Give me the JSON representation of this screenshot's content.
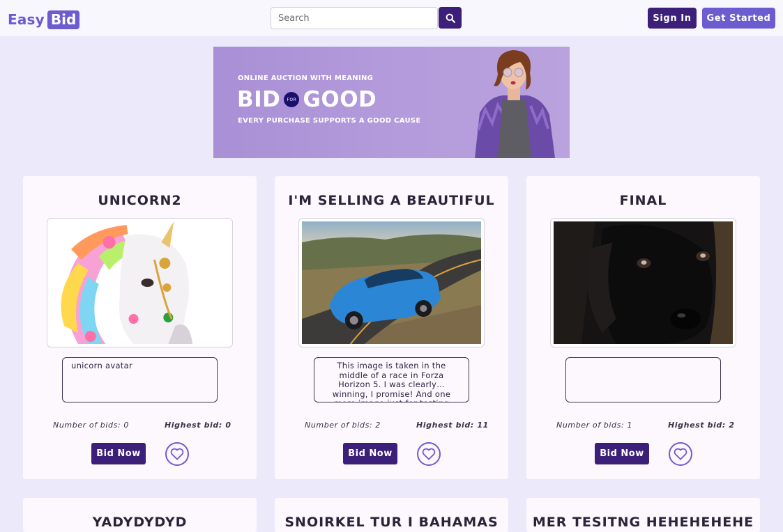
{
  "header": {
    "logo_part1": "Easy",
    "logo_part2": "Bid",
    "search_placeholder": "Search",
    "signin_label": "Sign In",
    "get_started_label": "Get Started"
  },
  "banner": {
    "kicker": "ONLINE AUCTION WITH MEANING",
    "headline_left": "BID",
    "headline_connector": "FOR",
    "headline_right": "GOOD",
    "subline": "EVERY PURCHASE SUPPORTS A GOOD CAUSE"
  },
  "colors": {
    "page_bg": "#ece9fb",
    "primary_dark": "#3b1f78",
    "primary_light": "#6c5ccf",
    "card_bg": "#fdf7fe"
  },
  "cards": [
    {
      "title": "UNICORN2",
      "description": "unicorn avatar",
      "bids_text": "Number of bids: 0",
      "highest_text": "Highest bid: 0",
      "bid_label": "Bid Now",
      "image": "unicorn-image"
    },
    {
      "title": "I'M SELLING A BEAUTIFUL",
      "description": "This image is taken in the middle of a race in Forza Horizon 5. I was clearly… winning, I promise! And one more image just for testing",
      "bids_text": "Number of bids: 2",
      "highest_text": "Highest bid: 11",
      "bid_label": "Bid Now",
      "image": "car-image"
    },
    {
      "title": "FINAL",
      "description": "",
      "bids_text": "Number of bids: 1",
      "highest_text": "Highest bid: 2",
      "bid_label": "Bid Now",
      "image": "dog-image"
    },
    {
      "title": "YADYDYDYD"
    },
    {
      "title": "SNOIRKEL TUR I BAHAMAS"
    },
    {
      "title": "MER TESITNG HEHEHEHEHE"
    }
  ]
}
